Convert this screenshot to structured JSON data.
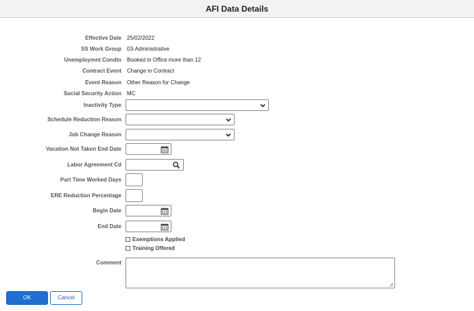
{
  "header": {
    "title": "AFI Data Details"
  },
  "readonly": [
    {
      "label": "Effective Date",
      "value": "25/02/2022"
    },
    {
      "label": "SS Work Group",
      "value": "03-Administrative"
    },
    {
      "label": "Unemploymnt Condtn",
      "value": "Booked in Office more than 12"
    },
    {
      "label": "Contract Event",
      "value": "Change in Contract"
    },
    {
      "label": "Event Reason",
      "value": "Other Reason for Change"
    },
    {
      "label": "Social Security Action",
      "value": "MC"
    }
  ],
  "fields": {
    "inactivity_type": {
      "label": "Inactivity Type",
      "value": ""
    },
    "schedule_reduction_reason": {
      "label": "Schedule Reduction Reason",
      "value": ""
    },
    "job_change_reason": {
      "label": "Job Change Reason",
      "value": ""
    },
    "vacation_not_taken_end_date": {
      "label": "Vacation Not Taken End Date",
      "value": ""
    },
    "labor_agreement_cd": {
      "label": "Labor Agreement Cd",
      "value": ""
    },
    "part_time_worked_days": {
      "label": "Part Time Worked Days",
      "value": ""
    },
    "ere_reduction_percentage": {
      "label": "ERE Reduction Percentage",
      "value": ""
    },
    "begin_date": {
      "label": "Begin Date",
      "value": ""
    },
    "end_date": {
      "label": "End Date",
      "value": ""
    },
    "comment": {
      "label": "Comment",
      "value": ""
    }
  },
  "checkboxes": {
    "exemptions_applied": {
      "label": "Exemptions Applied",
      "checked": false
    },
    "training_offered": {
      "label": "Training Offered",
      "checked": false
    }
  },
  "buttons": {
    "ok": "OK",
    "cancel": "Cancel"
  },
  "icons": {
    "dropdown": "chevron-down-icon",
    "calendar": "calendar-icon",
    "lookup": "search-icon"
  },
  "colors": {
    "primary": "#1e6fd0",
    "header_bg": "#f2f2f2"
  }
}
